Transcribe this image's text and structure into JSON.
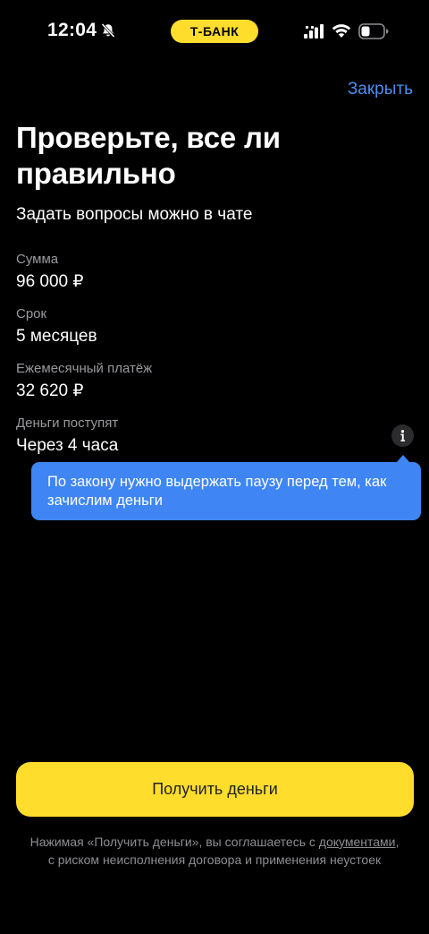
{
  "status_bar": {
    "time": "12:04",
    "carrier": "Т-БАНК",
    "icons": [
      "bell-off-icon",
      "signal-icon",
      "wifi-icon",
      "battery-icon"
    ]
  },
  "header": {
    "close_label": "Закрыть"
  },
  "main": {
    "title": "Проверьте, все ли правильно",
    "subtitle": "Задать вопросы можно в чате",
    "fields": [
      {
        "label": "Сумма",
        "value": "96 000 ₽"
      },
      {
        "label": "Срок",
        "value": "5 месяцев"
      },
      {
        "label": "Ежемесячный платёж",
        "value": "32 620 ₽"
      },
      {
        "label": "Деньги поступят",
        "value": "Через 4 часа"
      }
    ],
    "tooltip": "По закону нужно выдержать паузу перед тем, как зачислим деньги"
  },
  "footer": {
    "button_label": "Получить деньги",
    "legal_before": "Нажимая «Получить деньги», вы соглашаетесь с ",
    "legal_link": "документами",
    "legal_after": ", с риском неисполнения договора и применения неустоек"
  },
  "colors": {
    "background": "#000000",
    "accent_yellow": "#ffdd2d",
    "link_blue": "#4d8eef",
    "tooltip_blue": "#3f86f4",
    "secondary_text": "#9a9a9e"
  }
}
